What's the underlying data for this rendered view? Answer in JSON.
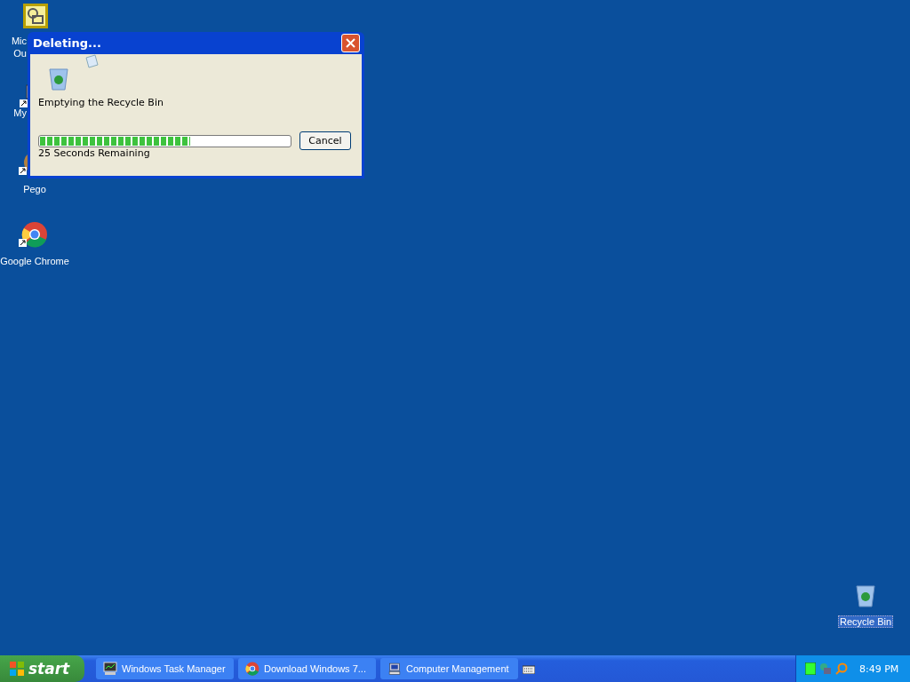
{
  "desktop_icons": [
    {
      "kind": "outlook",
      "label_lines": [
        "Mic",
        "Ou"
      ],
      "selected": false
    },
    {
      "kind": "computer",
      "label_lines": [
        "My"
      ],
      "selected": false
    },
    {
      "kind": "pego",
      "label_lines": [
        "Pego"
      ],
      "selected": false
    },
    {
      "kind": "chrome",
      "label_lines": [
        "Google Chrome"
      ],
      "selected": false
    },
    {
      "kind": "recycle",
      "label_lines": [
        "Recycle Bin"
      ],
      "selected": true
    }
  ],
  "dialog": {
    "title": "Deleting...",
    "message": "Emptying the Recycle Bin",
    "progress": {
      "level": 0.6
    },
    "time_remaining": "25 Seconds Remaining",
    "button": "Cancel"
  },
  "taskbar": {
    "start": "start",
    "tasks": [
      {
        "kind": "taskmgr",
        "label": "Windows Task Manager"
      },
      {
        "kind": "chrome",
        "label": "Download Windows 7..."
      },
      {
        "kind": "computer",
        "label": "Computer Management"
      }
    ],
    "clock": "8:49 PM"
  }
}
